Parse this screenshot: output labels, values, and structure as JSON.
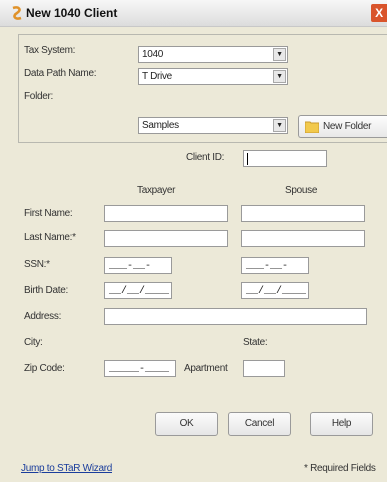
{
  "window": {
    "title": "New 1040 Client",
    "close_label": "X"
  },
  "group": {
    "tax_system_label": "Tax System:",
    "tax_system_value": "1040",
    "data_path_label": "Data Path Name:",
    "data_path_value": "T Drive",
    "folder_label": "Folder:",
    "folder_value": "Samples",
    "new_folder_label": "New Folder"
  },
  "client": {
    "id_label": "Client ID:",
    "id_value": ""
  },
  "columns": {
    "taxpayer": "Taxpayer",
    "spouse": "Spouse"
  },
  "fields": {
    "first_name": "First Name:",
    "last_name": "Last Name:*",
    "ssn": "SSN:*",
    "birth_date": "Birth Date:",
    "address": "Address:",
    "city": "City:",
    "state": "State:",
    "zip_code": "Zip Code:",
    "apartment": "Apartment"
  },
  "masks": {
    "ssn": "___-__-____",
    "date": "__/__/____",
    "zip": "_____-____"
  },
  "buttons": {
    "ok": "OK",
    "cancel": "Cancel",
    "help": "Help"
  },
  "footer": {
    "wizard_link": "Jump to STaR Wizard",
    "required_note": "* Required Fields"
  },
  "colors": {
    "accent": "#1a3d9c",
    "close": "#d9542b",
    "dialog_bg": "#ece9d8"
  }
}
